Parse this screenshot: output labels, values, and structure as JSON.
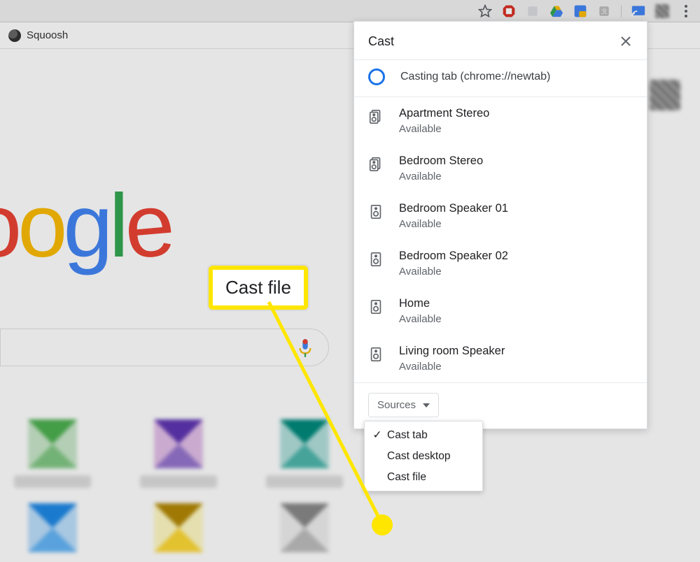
{
  "toolbar": {
    "bookmark_label": "Squoosh"
  },
  "cast": {
    "title": "Cast",
    "casting_label": "Casting tab (chrome://newtab)",
    "devices": [
      {
        "name": "Apartment Stereo",
        "status": "Available",
        "icon": "speaker-group"
      },
      {
        "name": "Bedroom Stereo",
        "status": "Available",
        "icon": "speaker-group"
      },
      {
        "name": "Bedroom Speaker 01",
        "status": "Available",
        "icon": "speaker"
      },
      {
        "name": "Bedroom Speaker 02",
        "status": "Available",
        "icon": "speaker"
      },
      {
        "name": "Home",
        "status": "Available",
        "icon": "speaker"
      },
      {
        "name": "Living room Speaker",
        "status": "Available",
        "icon": "speaker"
      }
    ],
    "sources_label": "Sources",
    "sources_menu": {
      "cast_tab": "Cast tab",
      "cast_desktop": "Cast desktop",
      "cast_file": "Cast file"
    }
  },
  "callout": {
    "label": "Cast file"
  },
  "google_logo": {
    "o1": "o",
    "o2": "o",
    "g2": "g",
    "l": "l",
    "e": "e"
  }
}
